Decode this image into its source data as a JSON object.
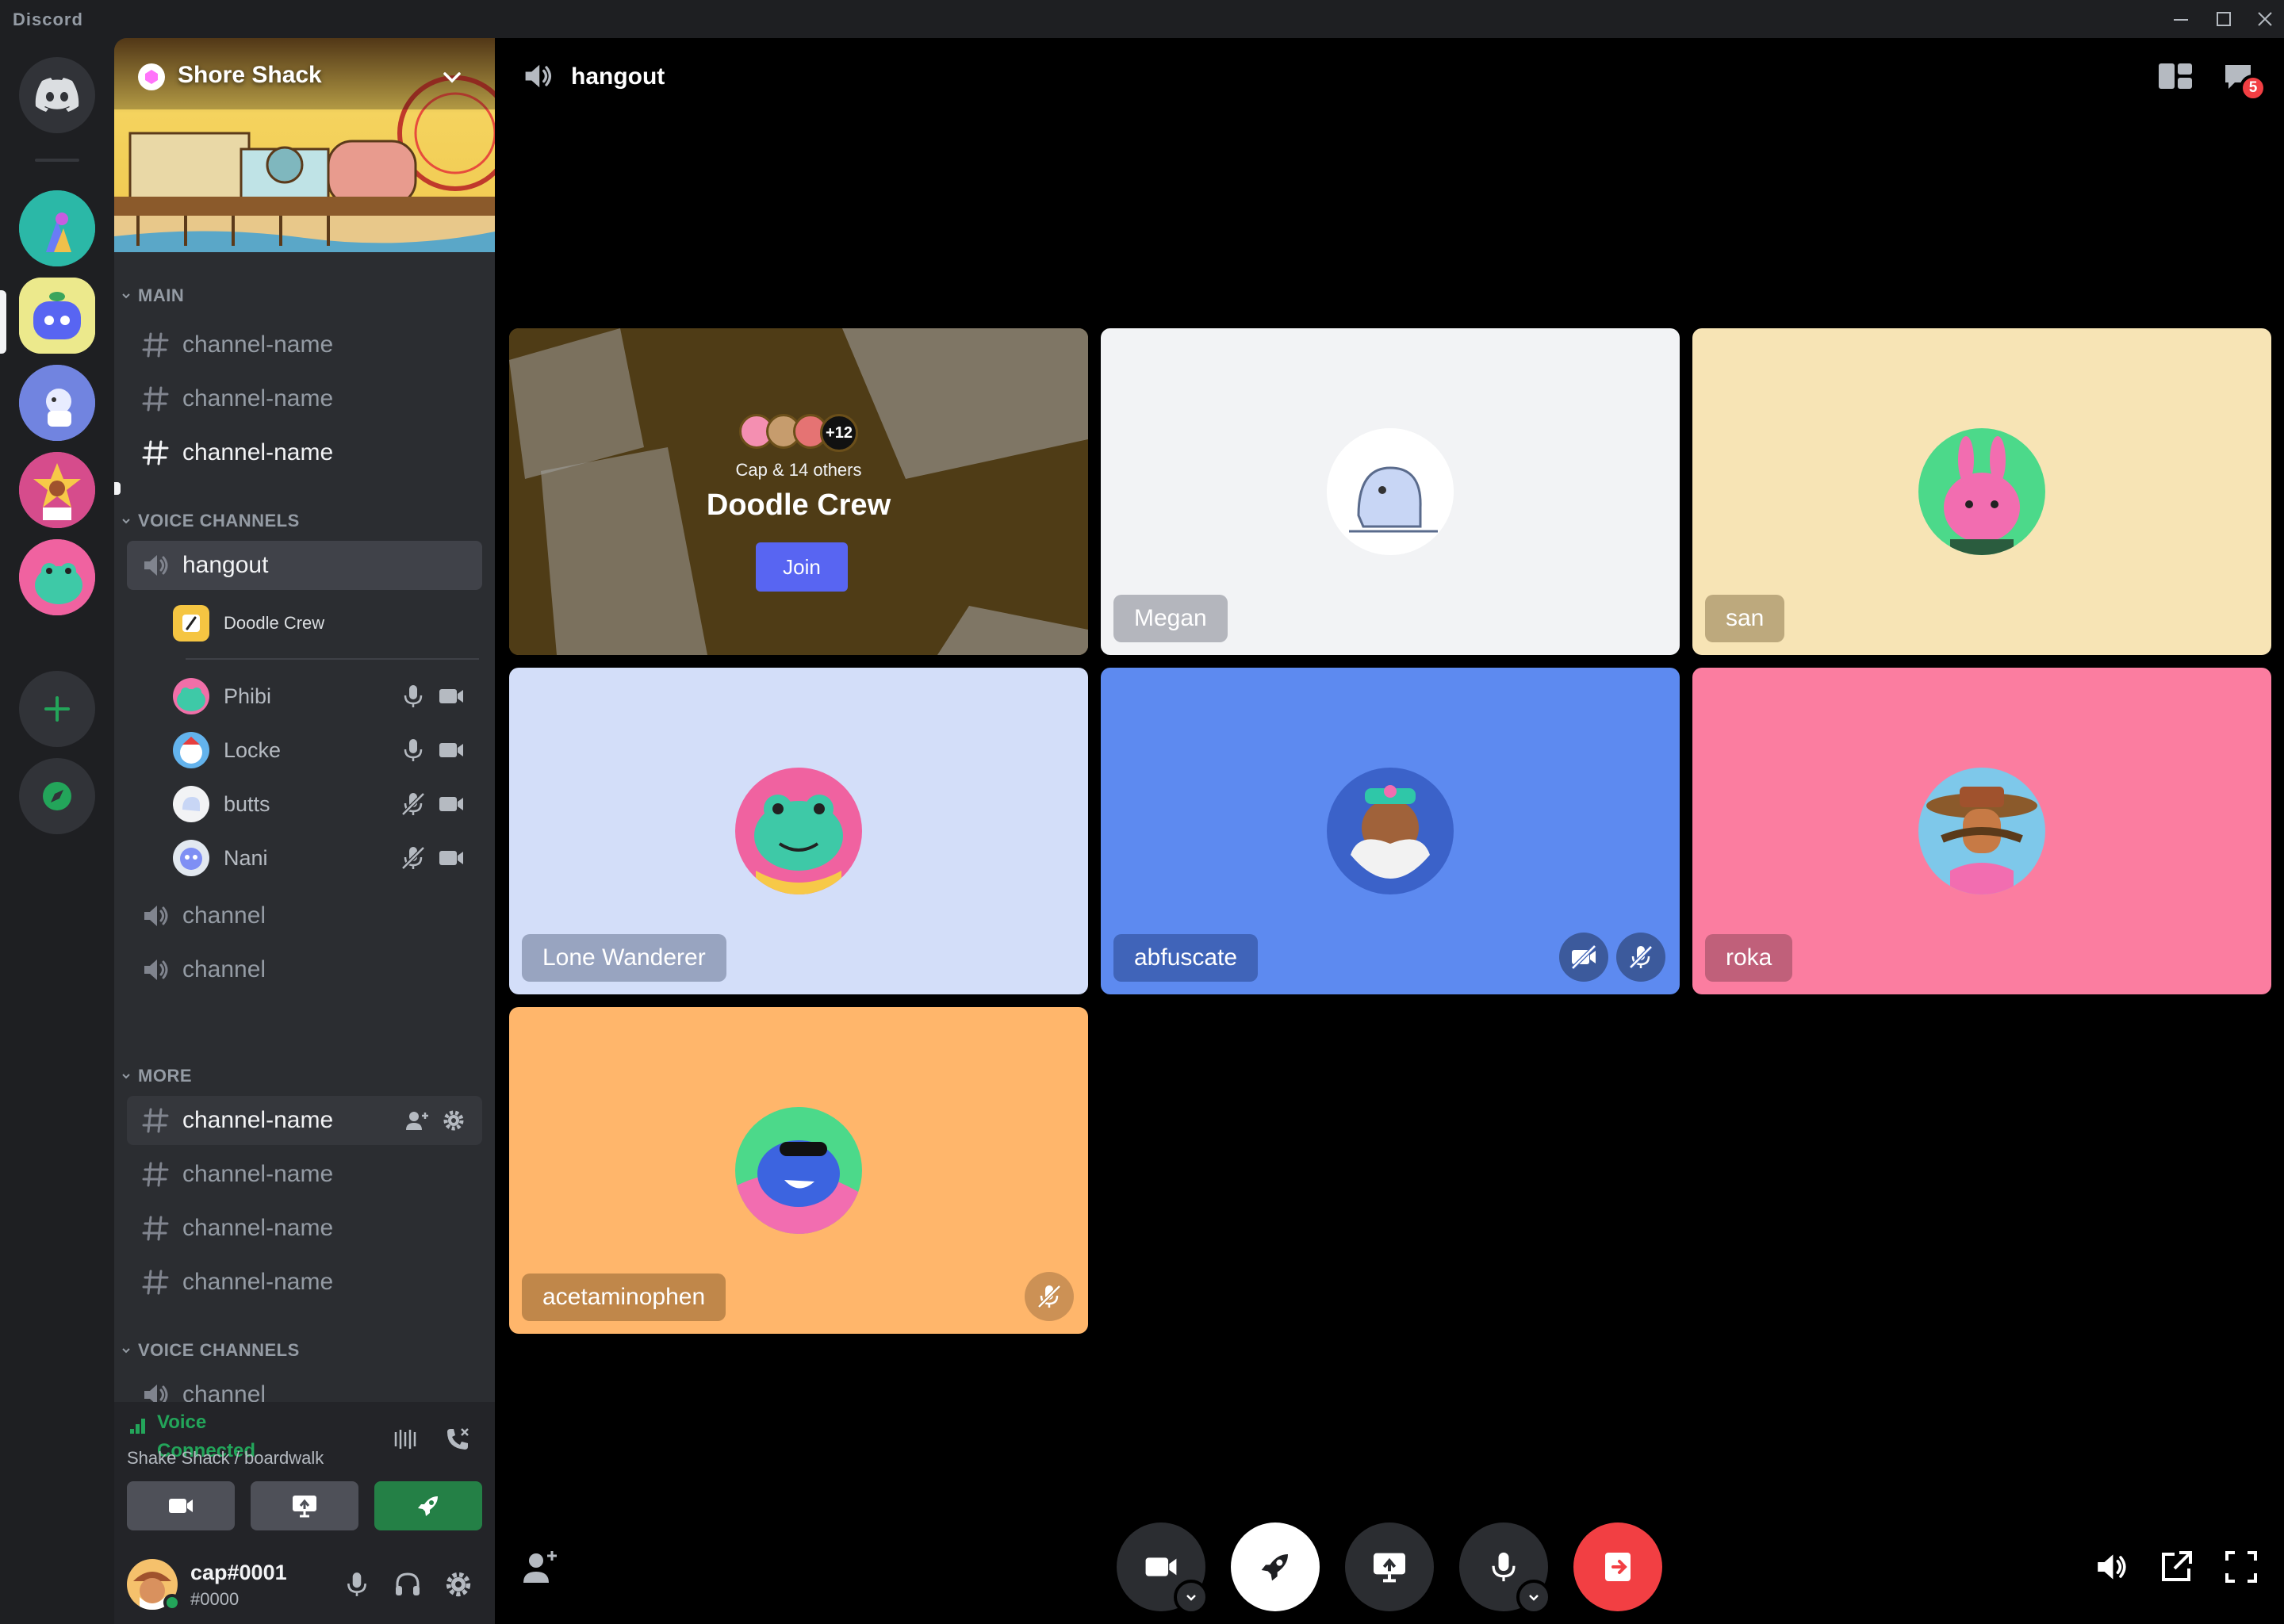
{
  "app": {
    "title": "Discord"
  },
  "server": {
    "name": "Shore Shack"
  },
  "categories": {
    "main": "MAIN",
    "voice1": "VOICE CHANNELS",
    "more": "MORE",
    "voice2": "VOICE CHANNELS"
  },
  "main_channels": [
    "channel-name",
    "channel-name",
    "channel-name"
  ],
  "voice_channels": {
    "hangout": "hangout",
    "activity": "Doodle Crew",
    "members": [
      {
        "name": "Phibi",
        "mic": "on"
      },
      {
        "name": "Locke",
        "mic": "on"
      },
      {
        "name": "butts",
        "mic": "muted"
      },
      {
        "name": "Nani",
        "mic": "muted"
      }
    ],
    "others": [
      "channel",
      "channel"
    ]
  },
  "more_channels": [
    "channel-name",
    "channel-name",
    "channel-name",
    "channel-name"
  ],
  "voice2_channels": [
    "channel"
  ],
  "voice_status": {
    "status": "Voice Connected",
    "location": "Shake Shack / boardwalk"
  },
  "user": {
    "name": "cap#0001",
    "tag": "#0000"
  },
  "header": {
    "channel": "hangout",
    "inbox_badge": "5"
  },
  "activity_tile": {
    "participants": "Cap & 14 others",
    "extra_count": "+12",
    "title": "Doodle Crew",
    "join_label": "Join"
  },
  "tiles": [
    {
      "name": "Megan",
      "bg": "#f2f3f5"
    },
    {
      "name": "san",
      "bg": "#f7e4b5"
    },
    {
      "name": "Lone Wanderer",
      "bg": "#d3def9"
    },
    {
      "name": "abfuscate",
      "bg": "#5d8af0"
    },
    {
      "name": "roka",
      "bg": "#fb7da0"
    },
    {
      "name": "acetaminophen",
      "bg": "#ffb66b"
    }
  ],
  "colors": {
    "accent": "#5865f2",
    "green": "#248046",
    "danger": "#f23f43",
    "connected": "#23a55a"
  }
}
